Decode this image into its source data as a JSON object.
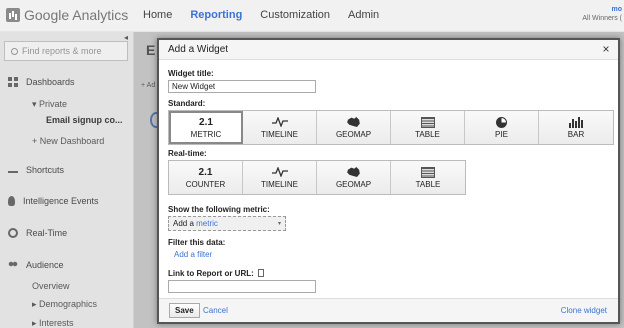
{
  "app": {
    "logo_text": "Google Analytics"
  },
  "topnav": {
    "home": "Home",
    "reporting": "Reporting",
    "customization": "Customization",
    "admin": "Admin"
  },
  "account": {
    "email": "mo",
    "property": "All Winners ("
  },
  "sidebar": {
    "search_placeholder": "Find reports & more",
    "collapse": "◂",
    "dashboards": "Dashboards",
    "private": "▾ Private",
    "email_signup": "Email signup co...",
    "new_dashboard": "+ New Dashboard",
    "shortcuts": "Shortcuts",
    "intelligence": "Intelligence Events",
    "realtime": "Real-Time",
    "audience": "Audience",
    "overview": "Overview",
    "demographics": "▸ Demographics",
    "interests": "▸ Interests"
  },
  "background": {
    "title": "E",
    "add": "+ Ad"
  },
  "modal": {
    "title": "Add a Widget",
    "close": "×",
    "widget_title_label": "Widget title:",
    "widget_title_value": "New Widget",
    "standard_label": "Standard:",
    "standard": [
      {
        "icon": "2.1",
        "label": "METRIC"
      },
      {
        "icon": "",
        "label": "TIMELINE"
      },
      {
        "icon": "",
        "label": "GEOMAP"
      },
      {
        "icon": "",
        "label": "TABLE"
      },
      {
        "icon": "",
        "label": "PIE"
      },
      {
        "icon": "",
        "label": "BAR"
      }
    ],
    "realtime_label": "Real-time:",
    "realtime": [
      {
        "icon": "2.1",
        "label": "COUNTER"
      },
      {
        "icon": "",
        "label": "TIMELINE"
      },
      {
        "icon": "",
        "label": "GEOMAP"
      },
      {
        "icon": "",
        "label": "TABLE"
      }
    ],
    "show_metric_label": "Show the following metric:",
    "add_prefix": "Add a",
    "add_metric_link": "metric",
    "filter_label": "Filter this data:",
    "add_filter": "Add a filter",
    "link_label": "Link to Report or URL:",
    "link_value": "",
    "save": "Save",
    "cancel": "Cancel",
    "clone": "Clone widget"
  },
  "colors": {
    "accent": "#3b73d1",
    "overlay": "#787878"
  }
}
